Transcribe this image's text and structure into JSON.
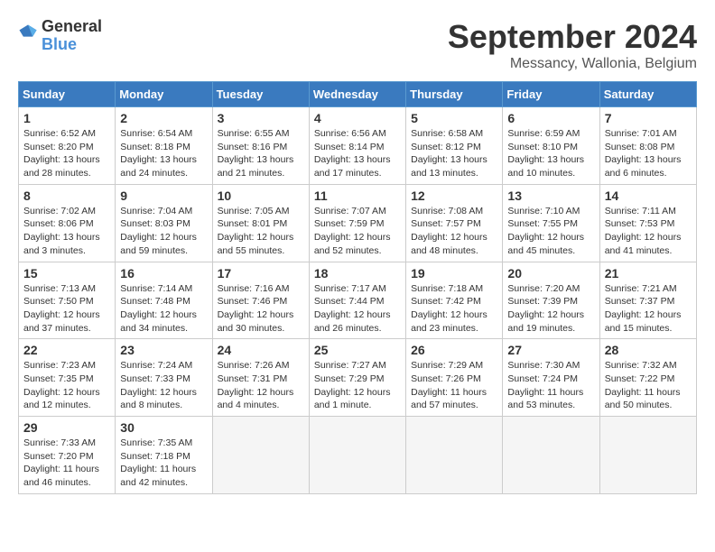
{
  "logo": {
    "general": "General",
    "blue": "Blue"
  },
  "title": "September 2024",
  "subtitle": "Messancy, Wallonia, Belgium",
  "days_of_week": [
    "Sunday",
    "Monday",
    "Tuesday",
    "Wednesday",
    "Thursday",
    "Friday",
    "Saturday"
  ],
  "weeks": [
    [
      {
        "day": "1",
        "info": "Sunrise: 6:52 AM\nSunset: 8:20 PM\nDaylight: 13 hours\nand 28 minutes."
      },
      {
        "day": "2",
        "info": "Sunrise: 6:54 AM\nSunset: 8:18 PM\nDaylight: 13 hours\nand 24 minutes."
      },
      {
        "day": "3",
        "info": "Sunrise: 6:55 AM\nSunset: 8:16 PM\nDaylight: 13 hours\nand 21 minutes."
      },
      {
        "day": "4",
        "info": "Sunrise: 6:56 AM\nSunset: 8:14 PM\nDaylight: 13 hours\nand 17 minutes."
      },
      {
        "day": "5",
        "info": "Sunrise: 6:58 AM\nSunset: 8:12 PM\nDaylight: 13 hours\nand 13 minutes."
      },
      {
        "day": "6",
        "info": "Sunrise: 6:59 AM\nSunset: 8:10 PM\nDaylight: 13 hours\nand 10 minutes."
      },
      {
        "day": "7",
        "info": "Sunrise: 7:01 AM\nSunset: 8:08 PM\nDaylight: 13 hours\nand 6 minutes."
      }
    ],
    [
      {
        "day": "8",
        "info": "Sunrise: 7:02 AM\nSunset: 8:06 PM\nDaylight: 13 hours\nand 3 minutes."
      },
      {
        "day": "9",
        "info": "Sunrise: 7:04 AM\nSunset: 8:03 PM\nDaylight: 12 hours\nand 59 minutes."
      },
      {
        "day": "10",
        "info": "Sunrise: 7:05 AM\nSunset: 8:01 PM\nDaylight: 12 hours\nand 55 minutes."
      },
      {
        "day": "11",
        "info": "Sunrise: 7:07 AM\nSunset: 7:59 PM\nDaylight: 12 hours\nand 52 minutes."
      },
      {
        "day": "12",
        "info": "Sunrise: 7:08 AM\nSunset: 7:57 PM\nDaylight: 12 hours\nand 48 minutes."
      },
      {
        "day": "13",
        "info": "Sunrise: 7:10 AM\nSunset: 7:55 PM\nDaylight: 12 hours\nand 45 minutes."
      },
      {
        "day": "14",
        "info": "Sunrise: 7:11 AM\nSunset: 7:53 PM\nDaylight: 12 hours\nand 41 minutes."
      }
    ],
    [
      {
        "day": "15",
        "info": "Sunrise: 7:13 AM\nSunset: 7:50 PM\nDaylight: 12 hours\nand 37 minutes."
      },
      {
        "day": "16",
        "info": "Sunrise: 7:14 AM\nSunset: 7:48 PM\nDaylight: 12 hours\nand 34 minutes."
      },
      {
        "day": "17",
        "info": "Sunrise: 7:16 AM\nSunset: 7:46 PM\nDaylight: 12 hours\nand 30 minutes."
      },
      {
        "day": "18",
        "info": "Sunrise: 7:17 AM\nSunset: 7:44 PM\nDaylight: 12 hours\nand 26 minutes."
      },
      {
        "day": "19",
        "info": "Sunrise: 7:18 AM\nSunset: 7:42 PM\nDaylight: 12 hours\nand 23 minutes."
      },
      {
        "day": "20",
        "info": "Sunrise: 7:20 AM\nSunset: 7:39 PM\nDaylight: 12 hours\nand 19 minutes."
      },
      {
        "day": "21",
        "info": "Sunrise: 7:21 AM\nSunset: 7:37 PM\nDaylight: 12 hours\nand 15 minutes."
      }
    ],
    [
      {
        "day": "22",
        "info": "Sunrise: 7:23 AM\nSunset: 7:35 PM\nDaylight: 12 hours\nand 12 minutes."
      },
      {
        "day": "23",
        "info": "Sunrise: 7:24 AM\nSunset: 7:33 PM\nDaylight: 12 hours\nand 8 minutes."
      },
      {
        "day": "24",
        "info": "Sunrise: 7:26 AM\nSunset: 7:31 PM\nDaylight: 12 hours\nand 4 minutes."
      },
      {
        "day": "25",
        "info": "Sunrise: 7:27 AM\nSunset: 7:29 PM\nDaylight: 12 hours\nand 1 minute."
      },
      {
        "day": "26",
        "info": "Sunrise: 7:29 AM\nSunset: 7:26 PM\nDaylight: 11 hours\nand 57 minutes."
      },
      {
        "day": "27",
        "info": "Sunrise: 7:30 AM\nSunset: 7:24 PM\nDaylight: 11 hours\nand 53 minutes."
      },
      {
        "day": "28",
        "info": "Sunrise: 7:32 AM\nSunset: 7:22 PM\nDaylight: 11 hours\nand 50 minutes."
      }
    ],
    [
      {
        "day": "29",
        "info": "Sunrise: 7:33 AM\nSunset: 7:20 PM\nDaylight: 11 hours\nand 46 minutes."
      },
      {
        "day": "30",
        "info": "Sunrise: 7:35 AM\nSunset: 7:18 PM\nDaylight: 11 hours\nand 42 minutes."
      },
      {
        "day": "",
        "info": ""
      },
      {
        "day": "",
        "info": ""
      },
      {
        "day": "",
        "info": ""
      },
      {
        "day": "",
        "info": ""
      },
      {
        "day": "",
        "info": ""
      }
    ]
  ]
}
